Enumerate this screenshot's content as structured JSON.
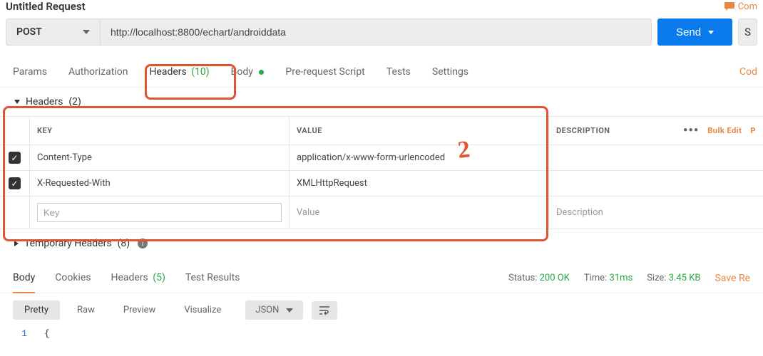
{
  "request": {
    "title": "Untitled Request",
    "method": "POST",
    "url": "http://localhost:8800/echart/androiddata",
    "send_label": "Send",
    "save_stub": "S",
    "comments_label": "Com"
  },
  "req_tabs": {
    "params": "Params",
    "authorization": "Authorization",
    "headers": "Headers",
    "headers_count": "(10)",
    "body": "Body",
    "prerequest": "Pre-request Script",
    "tests": "Tests",
    "settings": "Settings",
    "code_link": "Cod"
  },
  "headers_section": {
    "toggle_label": "Headers",
    "toggle_count": "(2)",
    "th_key": "KEY",
    "th_value": "VALUE",
    "th_desc": "DESCRIPTION",
    "row1": {
      "key": "Content-Type",
      "value": "application/x-www-form-urlencoded"
    },
    "row2": {
      "key": "X-Requested-With",
      "value": "XMLHttpRequest"
    },
    "ph_key": "Key",
    "ph_value": "Value",
    "ph_desc": "Description",
    "bulk_edit": "Bulk Edit",
    "preset_stub": "P"
  },
  "temp_headers": {
    "label": "Temporary Headers",
    "count": "(8)"
  },
  "response": {
    "tabs": {
      "body": "Body",
      "cookies": "Cookies",
      "headers": "Headers",
      "headers_count": "(5)",
      "results": "Test Results"
    },
    "status_label": "Status:",
    "status_value": "200 OK",
    "time_label": "Time:",
    "time_value": "31ms",
    "size_label": "Size:",
    "size_value": "3.45 KB",
    "save_resp": "Save Re",
    "formats": {
      "pretty": "Pretty",
      "raw": "Raw",
      "preview": "Preview",
      "visualize": "Visualize"
    },
    "content_type": "JSON",
    "line1_num": "1",
    "line1_txt": "{"
  },
  "annotation": {
    "two": "2"
  }
}
